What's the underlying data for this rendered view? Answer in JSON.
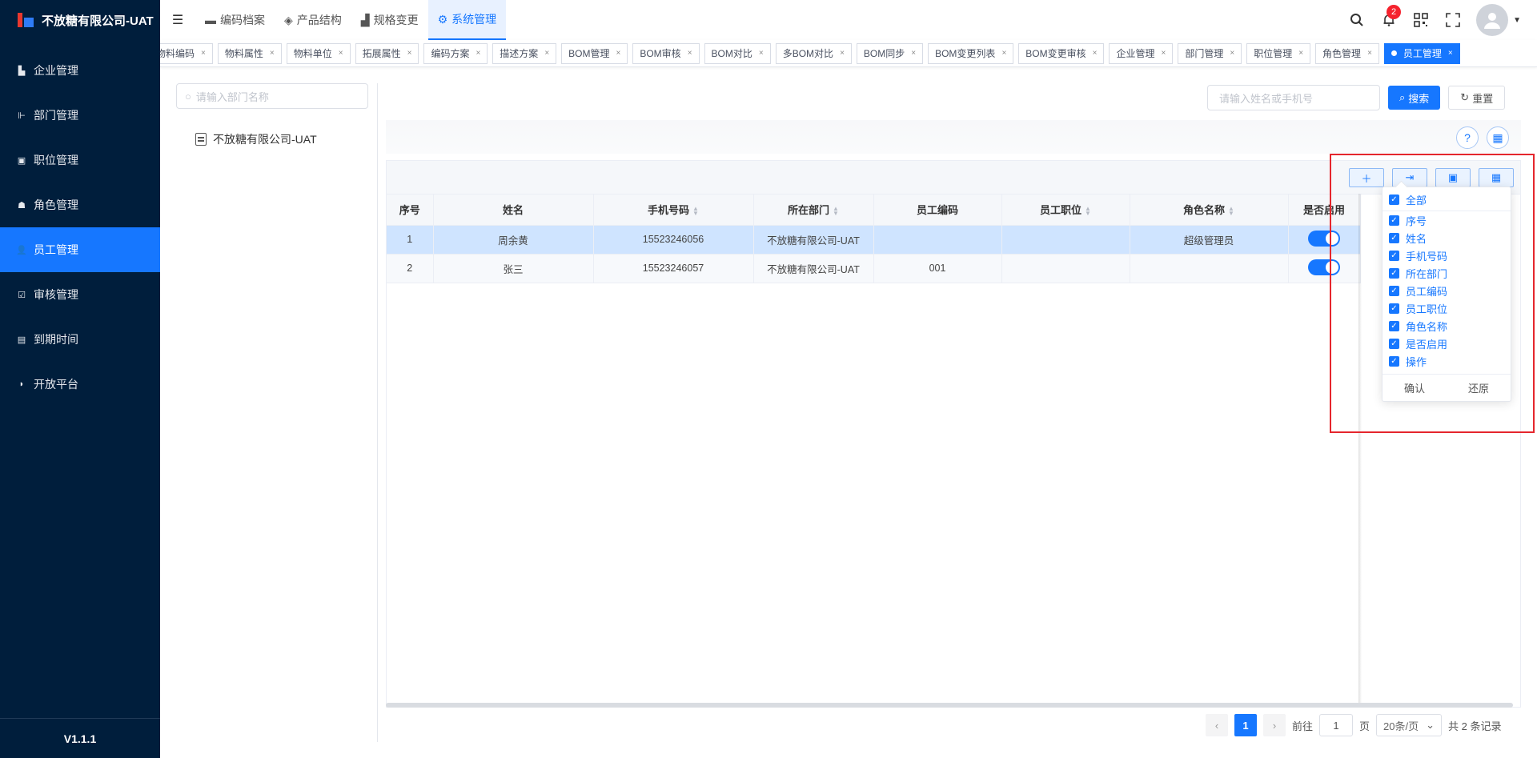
{
  "sidebar": {
    "logo_text": "不放糖有限公司-UAT",
    "items": [
      {
        "label": "企业管理",
        "icon": "building-icon"
      },
      {
        "label": "部门管理",
        "icon": "tree-icon"
      },
      {
        "label": "职位管理",
        "icon": "id-card-icon"
      },
      {
        "label": "角色管理",
        "icon": "role-icon"
      },
      {
        "label": "员工管理",
        "icon": "user-icon",
        "active": true
      },
      {
        "label": "审核管理",
        "icon": "check-square-icon"
      },
      {
        "label": "到期时间",
        "icon": "calendar-icon"
      },
      {
        "label": "开放平台",
        "icon": "platform-icon"
      }
    ],
    "version": "V1.1.1"
  },
  "header": {
    "nav_tabs": [
      {
        "label": "编码档案",
        "icon": "folder-icon"
      },
      {
        "label": "产品结构",
        "icon": "layers-icon"
      },
      {
        "label": "规格变更",
        "icon": "chart-icon"
      },
      {
        "label": "系统管理",
        "icon": "gear-icon",
        "active": true
      }
    ],
    "notification_count": "2"
  },
  "tabs": [
    {
      "label": "物料编码"
    },
    {
      "label": "物料属性"
    },
    {
      "label": "物料单位"
    },
    {
      "label": "拓展属性"
    },
    {
      "label": "编码方案"
    },
    {
      "label": "描述方案"
    },
    {
      "label": "BOM管理"
    },
    {
      "label": "BOM审核"
    },
    {
      "label": "BOM对比"
    },
    {
      "label": "多BOM对比"
    },
    {
      "label": "BOM同步"
    },
    {
      "label": "BOM变更列表"
    },
    {
      "label": "BOM变更审核"
    },
    {
      "label": "企业管理"
    },
    {
      "label": "部门管理"
    },
    {
      "label": "职位管理"
    },
    {
      "label": "角色管理"
    },
    {
      "label": "员工管理",
      "active": true
    }
  ],
  "dept_panel": {
    "search_placeholder": "请输入部门名称",
    "tree_root": "不放糖有限公司-UAT"
  },
  "search": {
    "placeholder": "请输入姓名或手机号",
    "search_label": "搜索",
    "reset_label": "重置"
  },
  "table": {
    "columns": [
      "序号",
      "姓名",
      "手机号码",
      "所在部门",
      "员工编码",
      "员工职位",
      "角色名称",
      "是否启用"
    ],
    "rows": [
      {
        "index": "1",
        "name": "周余黄",
        "phone": "15523246056",
        "dept": "不放糖有限公司-UAT",
        "code": "",
        "position": "",
        "role": "超级管理员",
        "enabled": true
      },
      {
        "index": "2",
        "name": "张三",
        "phone": "15523246057",
        "dept": "不放糖有限公司-UAT",
        "code": "001",
        "position": "",
        "role": "",
        "enabled": true
      }
    ]
  },
  "column_popover": {
    "all_label": "全部",
    "options": [
      "序号",
      "姓名",
      "手机号码",
      "所在部门",
      "员工编码",
      "员工职位",
      "角色名称",
      "是否启用",
      "操作"
    ],
    "confirm_label": "确认",
    "restore_label": "还原"
  },
  "pagination": {
    "current_page": "1",
    "goto_label": "前往",
    "goto_value": "1",
    "page_suffix": "页",
    "page_size": "20条/页",
    "total_text": "共 2 条记录"
  },
  "colors": {
    "sidebar_bg": "#001e3c",
    "accent": "#1677ff",
    "highlight_box": "#e5262d"
  }
}
